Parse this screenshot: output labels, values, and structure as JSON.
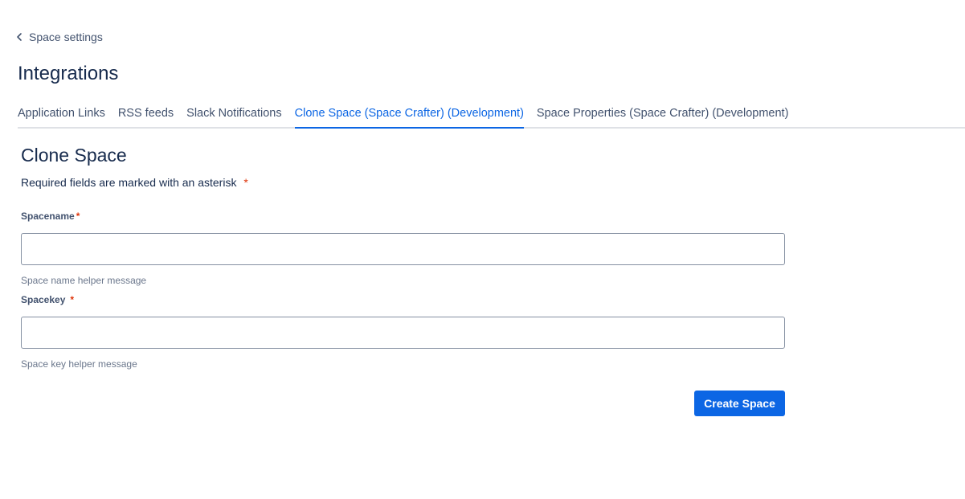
{
  "breadcrumb": {
    "back_label": "Space settings",
    "icon": "chevron-left-icon"
  },
  "page_title": "Integrations",
  "tabs": [
    {
      "label": "Application Links",
      "active": false
    },
    {
      "label": "RSS feeds",
      "active": false
    },
    {
      "label": "Slack Notifications",
      "active": false
    },
    {
      "label": "Clone Space (Space Crafter) (Development)",
      "active": true
    },
    {
      "label": "Space Properties (Space Crafter) (Development)",
      "active": false
    }
  ],
  "form": {
    "title": "Clone Space",
    "required_note": "Required fields are marked with an asterisk",
    "asterisk": "*",
    "spacename": {
      "label": "Spacename",
      "value": "",
      "helper": "Space name helper message"
    },
    "spacekey": {
      "label": "Spacekey",
      "value": "",
      "helper": "Space key helper message"
    },
    "submit_label": "Create Space"
  },
  "colors": {
    "accent": "#0c66e4",
    "text": "#172b4d",
    "required": "#de350b"
  }
}
